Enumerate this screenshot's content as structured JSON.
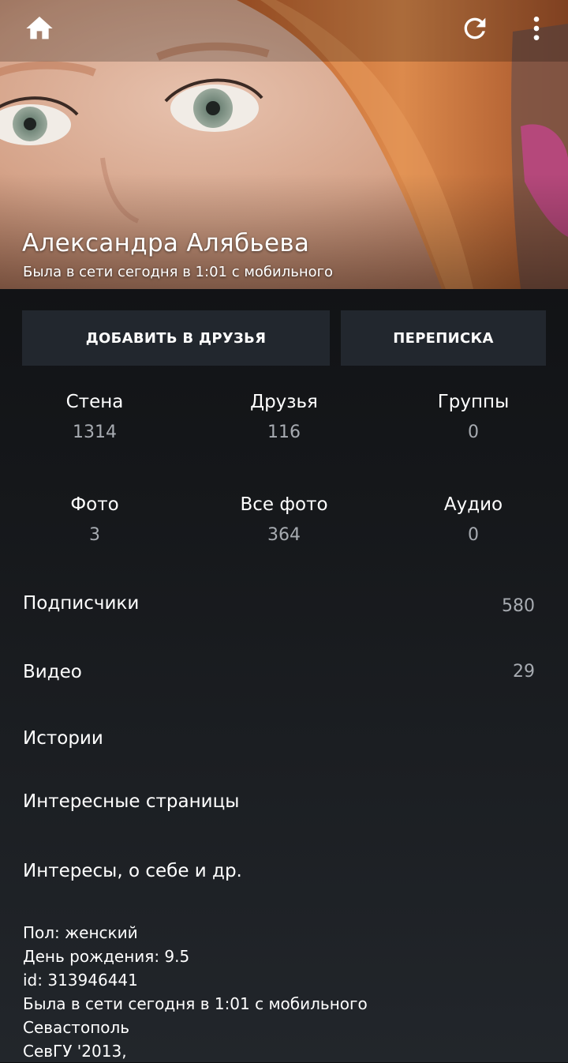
{
  "header": {
    "icons": {
      "home": "home-icon",
      "refresh": "refresh-icon",
      "more": "more-vertical-icon"
    }
  },
  "profile": {
    "name": "Александра Алябьева",
    "status": "Была в сети сегодня в 1:01 с мобильного"
  },
  "actions": {
    "add_friend": "ДОБАВИТЬ В ДРУЗЬЯ",
    "messages": "ПЕРЕПИСКА"
  },
  "stats": [
    {
      "label": "Стена",
      "value": "1314"
    },
    {
      "label": "Друзья",
      "value": "116"
    },
    {
      "label": "Группы",
      "value": "0"
    },
    {
      "label": "Фото",
      "value": "3"
    },
    {
      "label": "Все фото",
      "value": "364"
    },
    {
      "label": "Аудио",
      "value": "0"
    }
  ],
  "sections": [
    {
      "label": "Подписчики",
      "count": "580"
    },
    {
      "label": "Видео",
      "count": "29"
    },
    {
      "label": "Истории",
      "count": ""
    },
    {
      "label": "Интересные страницы",
      "count": ""
    },
    {
      "label": "Интересы, о себе и др.",
      "count": ""
    }
  ],
  "info": [
    "Пол: женский",
    "День рождения: 9.5",
    "id: 313946441",
    "Была в сети сегодня в 1:01 с мобильного",
    "Севастополь",
    "СевГУ '2013,"
  ],
  "colors": {
    "background_top": "#0c0d0f",
    "background_bottom": "#22262b",
    "button_bg": "#22272e",
    "text_primary": "#ffffff",
    "text_secondary": "#a7abb1"
  }
}
